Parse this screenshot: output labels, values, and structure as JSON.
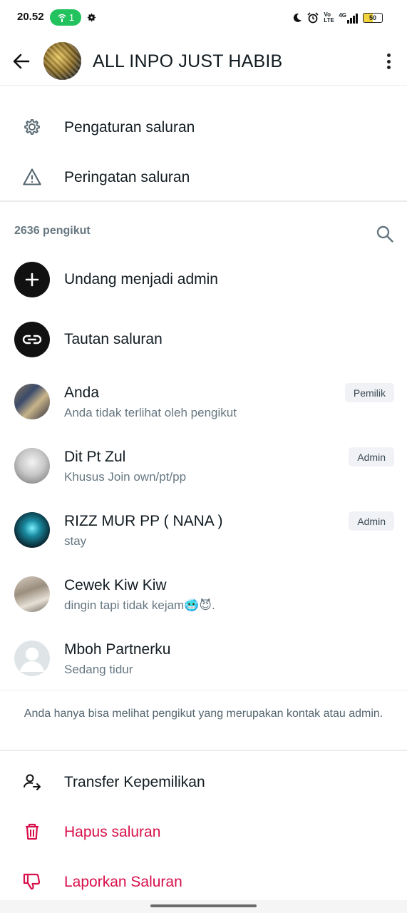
{
  "status_bar": {
    "time": "20.52",
    "hotspot_count": "1",
    "battery": "50",
    "network": "4G",
    "volte": "Vo LTE"
  },
  "header": {
    "title": "ALL INPO JUST HABIB",
    "back_icon": "arrow-left-icon",
    "more_icon": "more-vertical-icon"
  },
  "settings": {
    "items": [
      {
        "label": "Pengaturan saluran",
        "icon": "gear-icon"
      },
      {
        "label": "Peringatan saluran",
        "icon": "warning-icon"
      }
    ]
  },
  "followers": {
    "count_label": "2636 pengikut",
    "search_icon": "search-icon",
    "actions": [
      {
        "label": "Undang menjadi admin",
        "icon": "plus-icon"
      },
      {
        "label": "Tautan saluran",
        "icon": "link-icon"
      }
    ],
    "members": [
      {
        "name": "Anda",
        "subtitle": "Anda tidak terlihat oleh pengikut",
        "badge": "Pemilik"
      },
      {
        "name": "Dit Pt Zul",
        "subtitle": "Khusus Join own/pt/pp",
        "badge": "Admin"
      },
      {
        "name": "RIZZ MUR PP ( NANA )",
        "subtitle": "stay",
        "badge": "Admin"
      },
      {
        "name": "Cewek Kiw Kiw",
        "subtitle": "dingin tapi tidak kejam🥶😈.",
        "badge": ""
      },
      {
        "name": "Mboh Partnerku",
        "subtitle": "Sedang tidur",
        "badge": ""
      }
    ],
    "privacy_note": "Anda hanya bisa melihat pengikut yang merupakan kontak atau admin."
  },
  "bottom_actions": [
    {
      "label": "Transfer Kepemilikan",
      "icon": "transfer-user-icon"
    },
    {
      "label": "Hapus saluran",
      "icon": "trash-icon"
    },
    {
      "label": "Laporkan Saluran",
      "icon": "thumbs-down-icon"
    }
  ],
  "colors": {
    "danger": "#d70f4a",
    "secondary_text": "#667781",
    "hotspot_pill": "#22c35e"
  }
}
